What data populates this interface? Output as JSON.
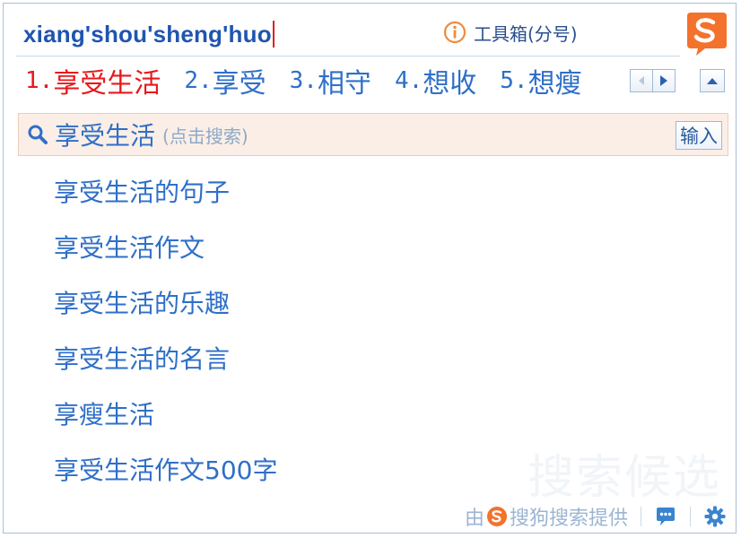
{
  "composition": {
    "pinyin": "xiang'shou'sheng'huo"
  },
  "toolbox": {
    "icon": "info-circle-icon",
    "label": "工具箱(分号)"
  },
  "logo": {
    "icon": "sogou-logo-icon",
    "color": "#f3722c"
  },
  "candidates": [
    {
      "num": "1.",
      "text": "享受生活",
      "selected": true
    },
    {
      "num": "2.",
      "text": "享受",
      "selected": false
    },
    {
      "num": "3.",
      "text": "相守",
      "selected": false
    },
    {
      "num": "4.",
      "text": "想收",
      "selected": false
    },
    {
      "num": "5.",
      "text": "想瘦",
      "selected": false
    }
  ],
  "paging": {
    "prev_icon": "chevron-left-icon",
    "next_icon": "chevron-right-icon",
    "collapse_icon": "chevron-up-icon"
  },
  "search": {
    "icon": "search-icon",
    "term": "享受生活",
    "hint": "(点击搜索)",
    "input_button": "输入"
  },
  "suggestions": [
    "享受生活的句子",
    "享受生活作文",
    "享受生活的乐趣",
    "享受生活的名言",
    "享瘦生活",
    "享受生活作文500字"
  ],
  "watermark": "搜索候选",
  "footer": {
    "prefix": "由",
    "provider": "搜狗搜索提供",
    "feedback_icon": "chat-bubble-icon",
    "settings_icon": "gear-icon"
  },
  "colors": {
    "selected_candidate": "#e8191b",
    "candidate": "#2f6fc8",
    "pinyin": "#1f55b0",
    "search_row_bg": "#fbeee6"
  }
}
